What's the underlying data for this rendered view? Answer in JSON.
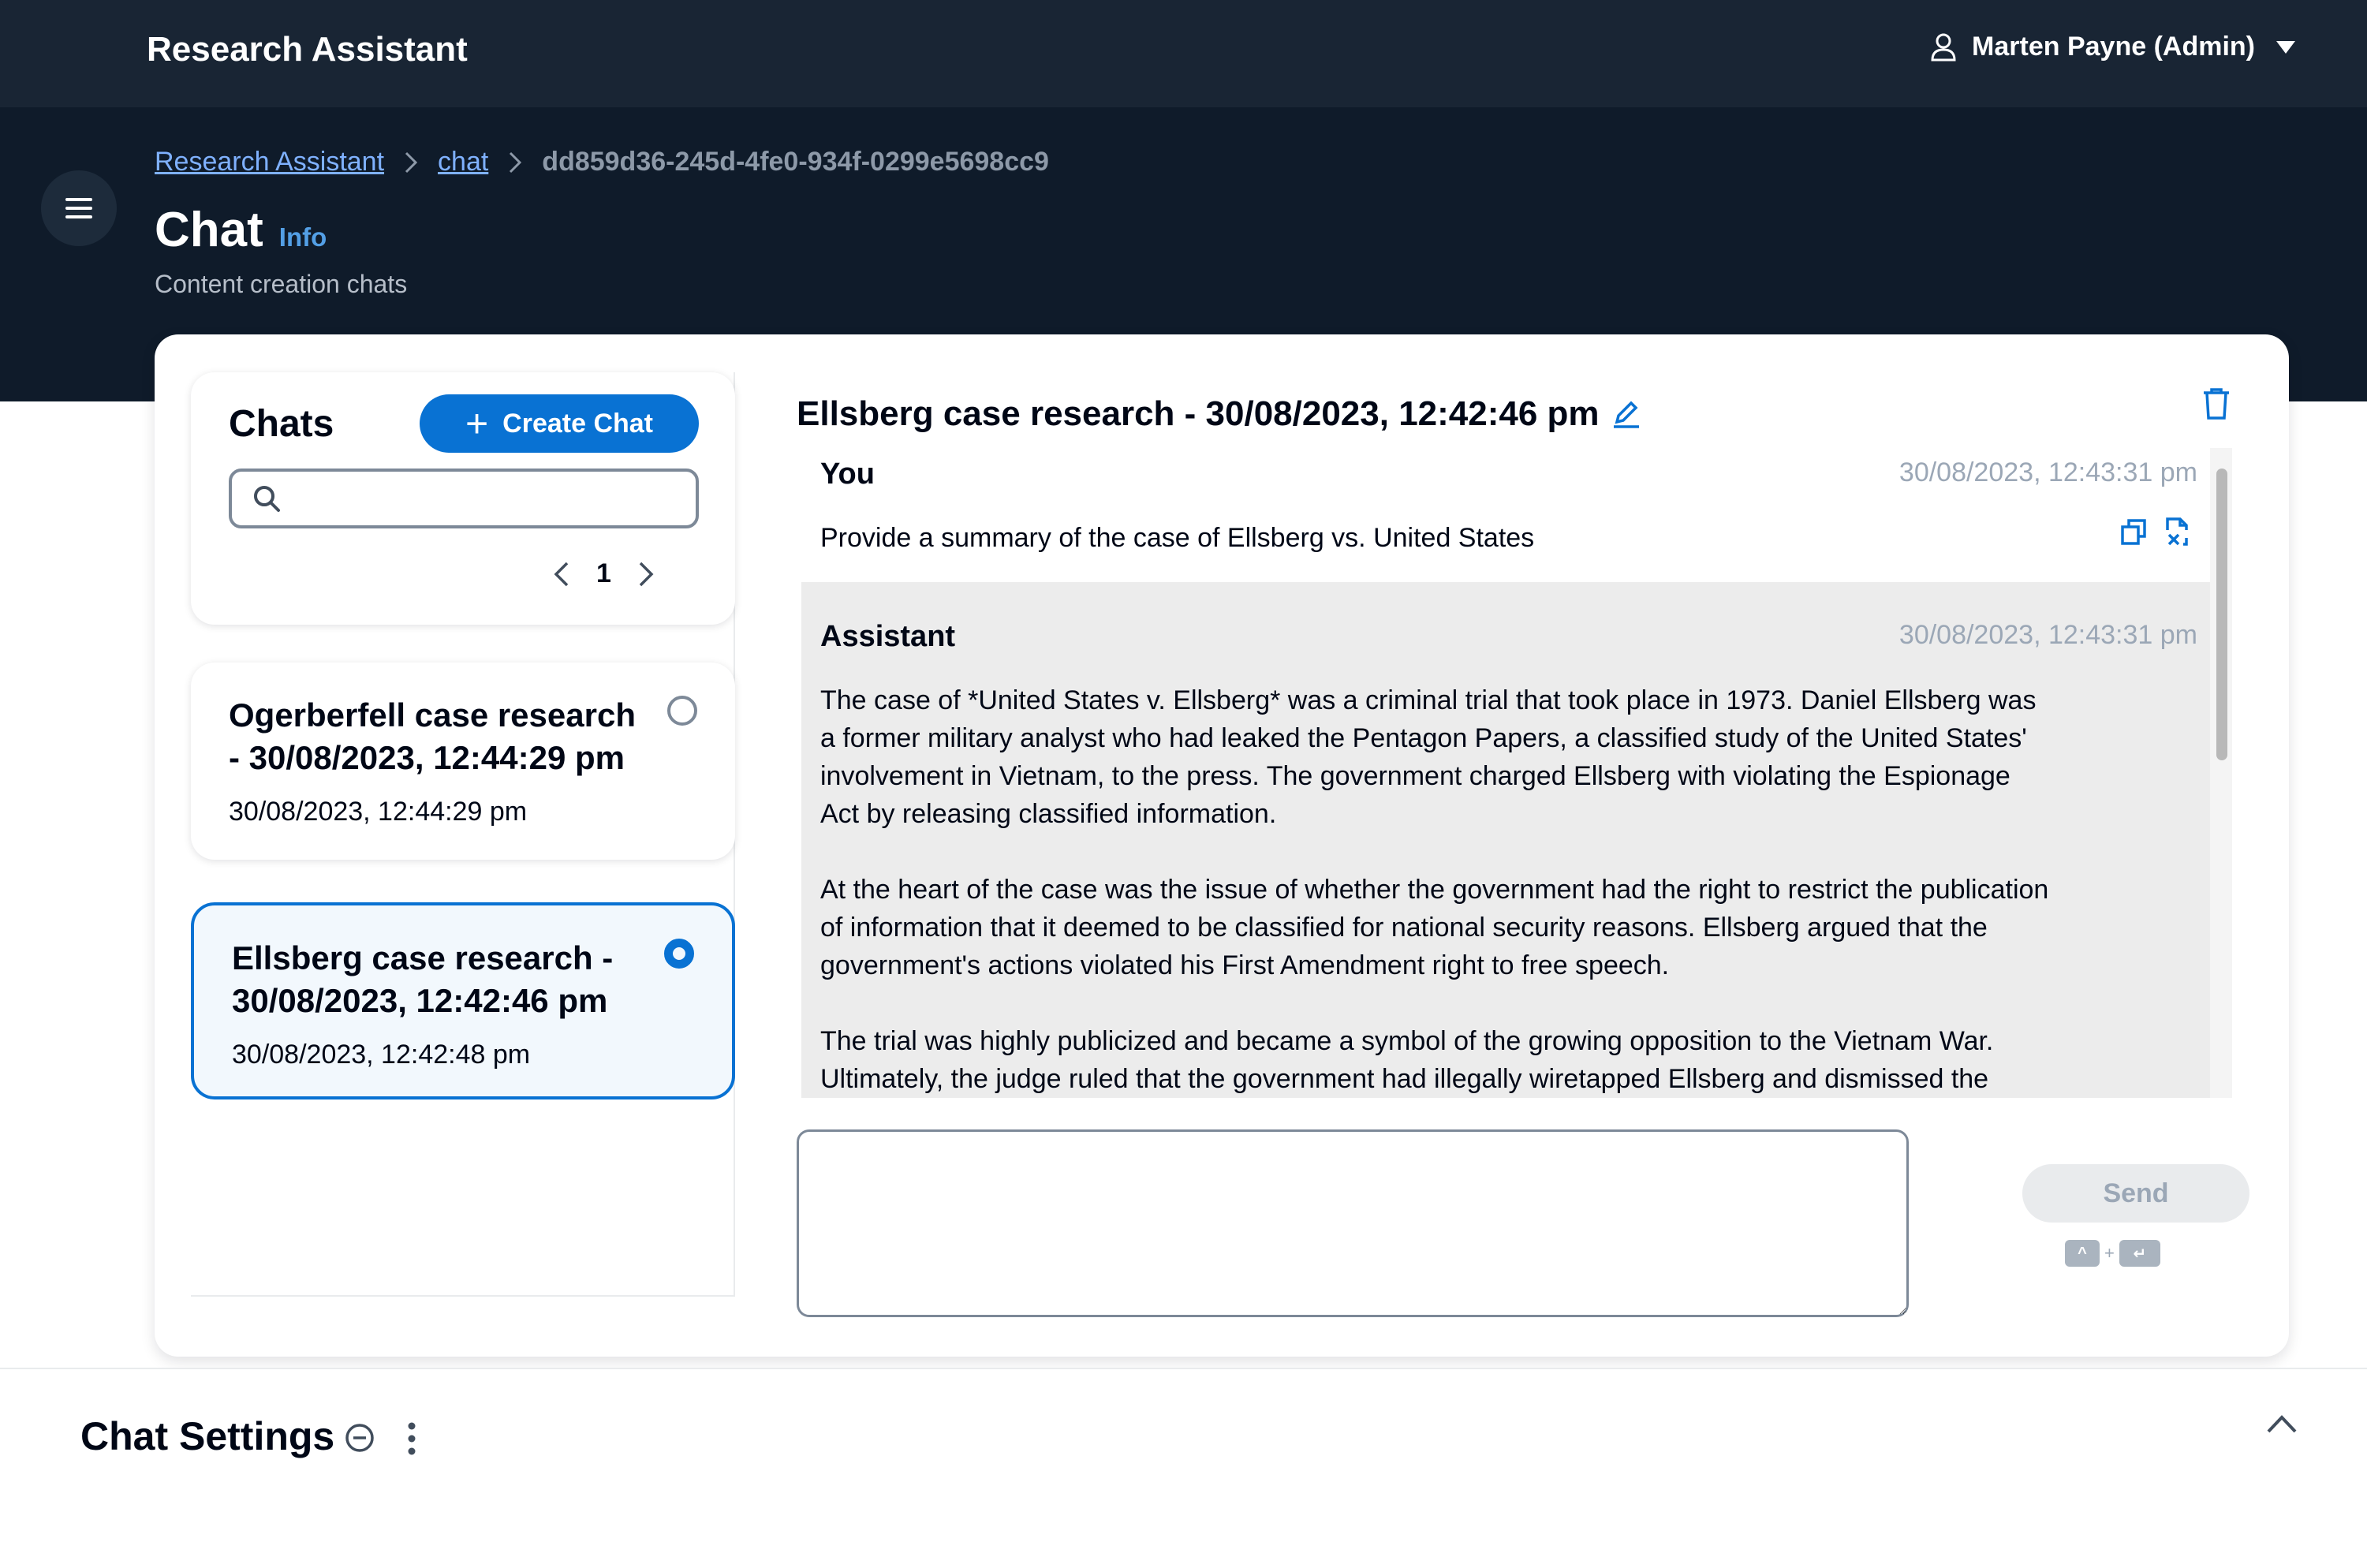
{
  "topnav": {
    "app_title": "Research Assistant",
    "user_label": "Marten Payne (Admin)"
  },
  "breadcrumb": {
    "items": [
      "Research Assistant",
      "chat"
    ],
    "current": "dd859d36-245d-4fe0-934f-0299e5698cc9"
  },
  "page": {
    "title": "Chat",
    "info_link": "Info",
    "description": "Content creation chats"
  },
  "sidebar": {
    "heading": "Chats",
    "create_label": "Create Chat",
    "search_placeholder": "",
    "page_number": "1",
    "items": [
      {
        "title": "Ogerberfell case research - 30/08/2023, 12:44:29 pm",
        "date": "30/08/2023, 12:44:29 pm",
        "selected": false
      },
      {
        "title": "Ellsberg case research - 30/08/2023, 12:42:46 pm",
        "date": "30/08/2023, 12:42:48 pm",
        "selected": true
      }
    ]
  },
  "chat": {
    "title": "Ellsberg case research - 30/08/2023, 12:42:46 pm",
    "messages": [
      {
        "sender": "You",
        "time": "30/08/2023, 12:43:31 pm",
        "text": "Provide a summary of the case of Ellsberg vs. United States"
      },
      {
        "sender": "Assistant",
        "time": "30/08/2023, 12:43:31 pm",
        "paragraphs": [
          "The case of *United States v. Ellsberg* was a criminal trial that took place in 1973. Daniel Ellsberg was a former military analyst who had leaked the Pentagon Papers, a classified study of the United States' involvement in Vietnam, to the press. The government charged Ellsberg with violating the Espionage Act by releasing classified information.",
          "At the heart of the case was the issue of whether the government had the right to restrict the publication of information that it deemed to be classified for national security reasons. Ellsberg argued that the government's actions violated his First Amendment right to free speech.",
          "The trial was highly publicized and became a symbol of the growing opposition to the Vietnam War. Ultimately, the judge ruled that the government had illegally wiretapped Ellsberg and dismissed the"
        ]
      }
    ],
    "prompt_value": "",
    "send_label": "Send",
    "shortcut_keys": [
      "^",
      "↵"
    ]
  },
  "settings": {
    "title": "Chat Settings"
  },
  "colors": {
    "nav_bg": "#192534",
    "header_bg": "#0f1b2a",
    "primary": "#0972d3",
    "link": "#7fb1ff",
    "assistant_bg": "#ececec"
  }
}
